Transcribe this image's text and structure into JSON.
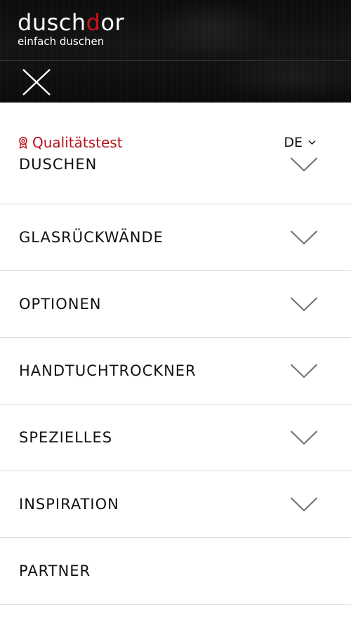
{
  "header": {
    "logo_prefix": "dusch",
    "logo_accent": "d",
    "logo_suffix": "or",
    "tagline": "einfach duschen",
    "accent_color": "#d0111b"
  },
  "topbar": {
    "quality_label": "Qualitätstest",
    "quality_icon": "award-ribbon-icon",
    "language": "DE",
    "language_icon": "chevron-down-icon"
  },
  "menu": {
    "items": [
      {
        "label": "DUSCHEN",
        "expandable": true
      },
      {
        "label": "GLASRÜCKWÄNDE",
        "expandable": true
      },
      {
        "label": "OPTIONEN",
        "expandable": true
      },
      {
        "label": "HANDTUCHTROCKNER",
        "expandable": true
      },
      {
        "label": "SPEZIELLES",
        "expandable": true
      },
      {
        "label": "INSPIRATION",
        "expandable": true
      },
      {
        "label": "PARTNER",
        "expandable": false
      }
    ]
  }
}
